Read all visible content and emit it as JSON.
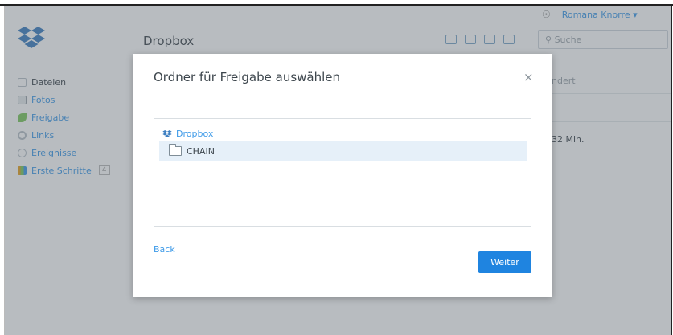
{
  "app": {
    "title": "Dropbox",
    "user_name": "Romana Knorre ▾",
    "search_placeholder": "Suche",
    "column_header_partial": "ndert",
    "row_value_partial": "32 Min.",
    "sidebar": [
      {
        "label": "Dateien",
        "icon": "file-icon"
      },
      {
        "label": "Fotos",
        "icon": "photo-icon"
      },
      {
        "label": "Freigabe",
        "icon": "share-icon"
      },
      {
        "label": "Links",
        "icon": "link-icon"
      },
      {
        "label": "Ereignisse",
        "icon": "events-icon"
      },
      {
        "label": "Erste Schritte",
        "icon": "chart-icon",
        "badge": "4"
      }
    ]
  },
  "modal": {
    "title": "Ordner für Freigabe auswählen",
    "close_glyph": "×",
    "tree": {
      "root_label": "Dropbox",
      "items": [
        {
          "label": "CHAIN",
          "selected": true
        }
      ]
    },
    "back_label": "Back",
    "next_label": "Weiter"
  },
  "colors": {
    "accent": "#1f84e0",
    "link": "#3d9ae8",
    "selection": "#e6f0f9"
  }
}
